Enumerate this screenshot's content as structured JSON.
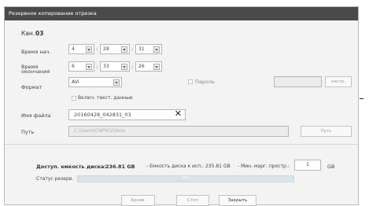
{
  "window": {
    "title": "Резервное копирование отрезка"
  },
  "channel": {
    "label": "Кан.",
    "value": "03"
  },
  "start_time": {
    "label": "Время нач.",
    "hour": "4",
    "minute": "28",
    "second": "31"
  },
  "end_time": {
    "label": "Время\nокончания",
    "hour": "6",
    "minute": "33",
    "second": "26"
  },
  "format": {
    "label": "Формат",
    "value": "AVI"
  },
  "password": {
    "label": "Пароль",
    "value": "",
    "settings_button": "настр."
  },
  "include_text": {
    "label": "Включ. текст. данные"
  },
  "file_name": {
    "label": "Имя файла",
    "value": "20160428_042831_03",
    "clear_icon": "close-icon"
  },
  "path": {
    "label": "Путь",
    "value": "C:\\Users\\CNPK\\Videos",
    "button": "Путь"
  },
  "disk": {
    "available_label": "Доступ. емкость диска:",
    "available_value": "236.81 GB",
    "usable_text": "- Емкость диска к исп.: 235.81 GB",
    "min_margin_label": "- Мин. марг. простр.:",
    "min_margin_value": "1",
    "min_margin_unit": "GB"
  },
  "status": {
    "label": "Статус резерв.",
    "percent_text": "0%",
    "progress": 0
  },
  "buttons": {
    "archive": "Архив.",
    "stop": "Стоп",
    "close": "Закрыть"
  }
}
